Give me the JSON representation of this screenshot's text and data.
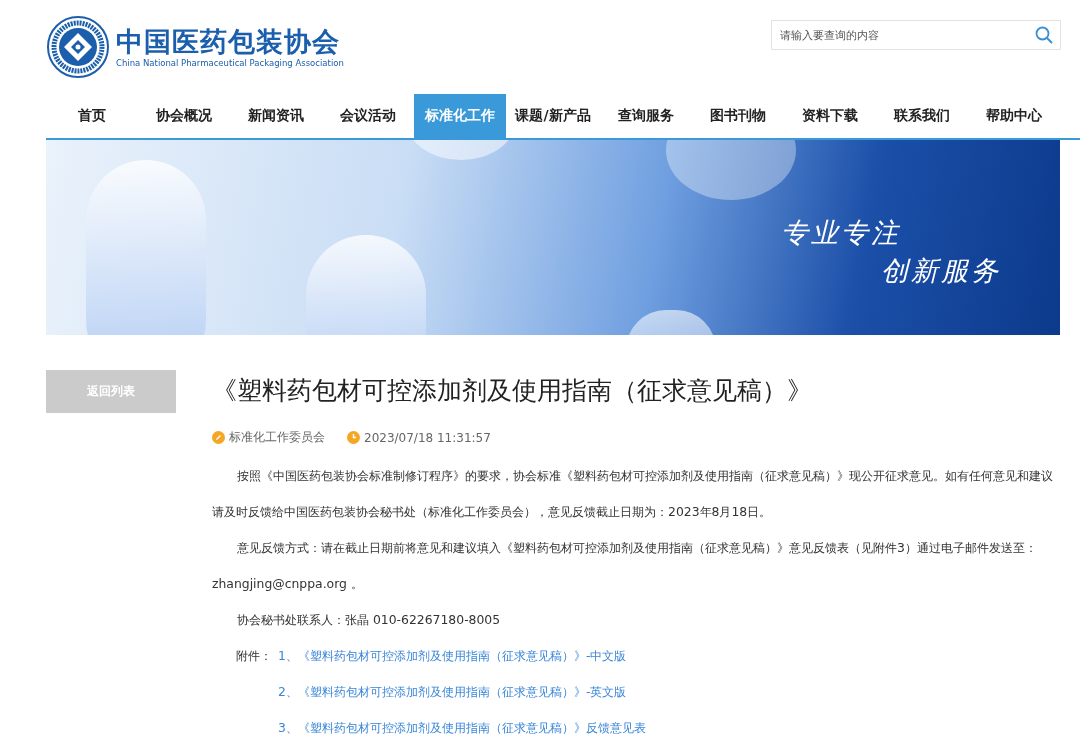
{
  "header": {
    "logo_title": "中国医药包装协会",
    "logo_subtitle": "China National Pharmaceutical Packaging Association",
    "search": {
      "placeholder": "请输入要查询的内容"
    }
  },
  "nav": [
    {
      "label": "首页",
      "selected": false
    },
    {
      "label": "协会概况",
      "selected": false
    },
    {
      "label": "新闻资讯",
      "selected": false
    },
    {
      "label": "会议活动",
      "selected": false
    },
    {
      "label": "标准化工作",
      "selected": true
    },
    {
      "label": "课题/新产品",
      "selected": false
    },
    {
      "label": "查询服务",
      "selected": false
    },
    {
      "label": "图书刊物",
      "selected": false
    },
    {
      "label": "资料下载",
      "selected": false
    },
    {
      "label": "联系我们",
      "selected": false
    },
    {
      "label": "帮助中心",
      "selected": false
    }
  ],
  "banner": {
    "slogan": [
      "专业专注",
      "创新服务"
    ]
  },
  "sidebar": {
    "back_button": "返回列表"
  },
  "article": {
    "title": "《塑料药包材可控添加剂及使用指南（征求意见稿）》",
    "source": "标准化工作委员会",
    "datetime": "2023/07/18 11:31:57",
    "paragraphs": [
      "按照《中国医药包装协会标准制修订程序》的要求，协会标准《塑料药包材可控添加剂及使用指南（征求意见稿）》现公开征求意见。如有任何意见和建议请及时反馈给中国医药包装协会秘书处（标准化工作委员会），意见反馈截止日期为：2023年8月18日。",
      "意见反馈方式：请在截止日期前将意见和建议填入《塑料药包材可控添加剂及使用指南（征求意见稿）》意见反馈表（见附件3）通过电子邮件发送至：zhangjing@cnppa.org 。",
      "协会秘书处联系人：张晶  010-62267180-8005"
    ],
    "attachments_label": "附件：",
    "attachments": [
      "1、《塑料药包材可控添加剂及使用指南（征求意见稿）》-中文版",
      "2、《塑料药包材可控添加剂及使用指南（征求意见稿）》-英文版",
      "3、《塑料药包材可控添加剂及使用指南（征求意见稿）》反馈意见表"
    ]
  }
}
